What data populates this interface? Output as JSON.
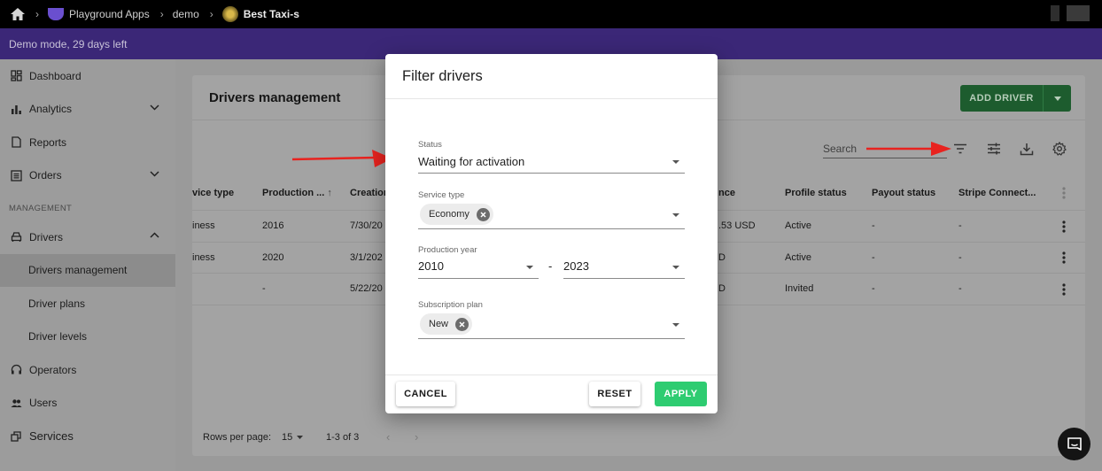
{
  "topbar": {
    "home_icon": "home-icon",
    "crumbs": [
      "Playground Apps",
      "demo",
      "Best Taxi-s"
    ]
  },
  "demo_banner": "Demo mode, 29 days left",
  "sidebar": {
    "items": [
      {
        "label": "Dashboard",
        "icon": "dashboard-icon"
      },
      {
        "label": "Analytics",
        "icon": "bar-chart-icon"
      },
      {
        "label": "Reports",
        "icon": "report-icon"
      },
      {
        "label": "Orders",
        "icon": "list-icon"
      }
    ],
    "section_label": "MANAGEMENT",
    "drivers": {
      "label": "Drivers",
      "icon": "car-icon"
    },
    "driver_sub": [
      "Drivers management",
      "Driver plans",
      "Driver levels"
    ],
    "bottom": [
      {
        "label": "Operators",
        "icon": "headset-icon"
      },
      {
        "label": "Users",
        "icon": "users-icon"
      },
      {
        "label": "Services",
        "icon": "services-icon"
      }
    ]
  },
  "main": {
    "title": "Drivers management",
    "add_driver_label": "ADD DRIVER",
    "search_placeholder": "Search",
    "columns": [
      "vice type",
      "Production ...",
      "Creation",
      "nce",
      "Profile status",
      "Payout status",
      "Stripe Connect..."
    ],
    "rows": [
      [
        "iness",
        "2016",
        "7/30/20",
        ".53 USD",
        "Active",
        "-",
        "-"
      ],
      [
        "iness",
        "2020",
        "3/1/202",
        "D",
        "Active",
        "-",
        "-"
      ],
      [
        "",
        "-",
        "5/22/20",
        "D",
        "Invited",
        "-",
        "-"
      ]
    ],
    "rows_per_page_label": "Rows per page:",
    "rows_per_page_value": "15",
    "page_range": "1-3 of 3"
  },
  "modal": {
    "title": "Filter drivers",
    "status_label": "Status",
    "status_value": "Waiting for activation",
    "service_type_label": "Service type",
    "service_type_chip": "Economy",
    "production_year_label": "Production year",
    "year_from": "2010",
    "year_sep": "-",
    "year_to": "2023",
    "subscription_label": "Subscription plan",
    "subscription_chip": "New",
    "cancel_label": "CANCEL",
    "reset_label": "RESET",
    "apply_label": "APPLY"
  },
  "colors": {
    "accent_purple": "#3b2777",
    "apply_green": "#2ecc71",
    "add_driver_green": "#1d5c2e",
    "annotation_red": "#e8231f"
  }
}
